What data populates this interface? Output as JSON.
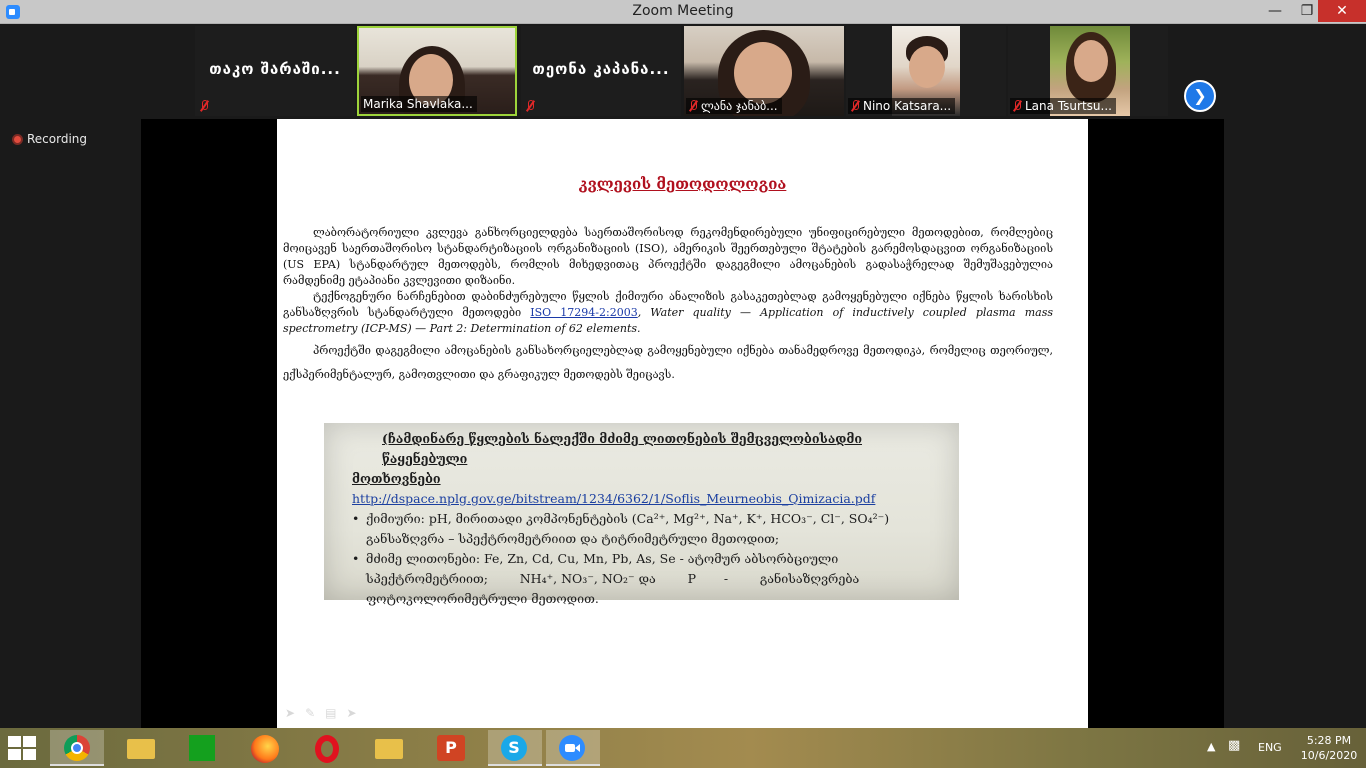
{
  "window": {
    "title": "Zoom Meeting"
  },
  "participants": [
    {
      "name": "თაკო შარაში..."
    },
    {
      "name": "Marika Shavlaka..."
    },
    {
      "name": "თეონა კაპანა..."
    },
    {
      "name": "ლანა ჯანაბ..."
    },
    {
      "name": "Nino Katsara..."
    },
    {
      "name": "Lana Tsurtsu..."
    }
  ],
  "recording": {
    "label": "Recording"
  },
  "slide": {
    "title": "კვლევის მეთოდოლოგია",
    "p1": "ლაბორატორიული კვლევა განხორციელდება საერთაშორისოდ რეკომენდირებული უნიფიცირებული მეთოდებით, რომლებიც მოიცავენ საერთაშორისო სტანდარტიზაციის ორგანიზაციის (ISO), ამერიკის შეერთებული შტატების გარემოსდაცვით ორგანიზაციის (US EPA) სტანდარტულ მეთოდებს, რომლის მიხედვითაც პროექტში დაგეგმილი ამოცანების გადასაჭრელად შემუშავებულია რამდენიმე ეტაპიანი კვლევითი დიზაინი.",
    "p2_pre": "ტექნოგენური ნარჩენებით დაბინძურებული წყლის ქიმიური ანალიზის გასაკეთებლად გამოყენებული იქნება წყლის ხარისხის განსაზღვრის სტანდარტული მეთოდები ",
    "p2_link": "ISO 17294-2:2003",
    "p2_italic": ", Water quality — Application of inductively coupled plasma mass spectrometry (ICP-MS) — Part 2: Determination of 62 elements.",
    "p3": "პროექტში დაგეგმილი ამოცანების განსახორციელებლად გამოყენებული იქნება თანამედროვე მეთოდიკა, რომელიც თეორიულ, ექსპერიმენტალურ, გამოთვლითი და გრაფიკულ მეთოდებს შეიცავს."
  },
  "photo": {
    "heading": "(ჩამდინარე წყლების ნალექში მძიმე ლითონების შემცველობისადმი წაყენებული",
    "heading2": "მოთხოვნები",
    "link": "http://dspace.nplg.gov.ge/bitstream/1234/6362/1/Soflis_Meurneobis_Qimizacia.pdf",
    "bullet1": "ქიმიური: pH, მირითადი კომპონენტების (Ca²⁺, Mg²⁺, Na⁺, K⁺, HCO₃⁻, Cl⁻, SO₄²⁻)",
    "bullet1b": "განსაზღვრა – სპექტრომეტრიით და ტიტრიმეტრული მეთოდით;",
    "bullet2": "მძიმე ლითონები: Fe, Zn, Cd, Cu, Mn, Pb, As, Se - ატომურ აბსორბციული",
    "bullet2b": "სპექტრომეტრიით;        NH₄⁺, NO₃⁻, NO₂⁻ და        P       -        განისაზღვრება",
    "bullet2c": "ფოტოკოლორიმეტრული მეთოდით."
  },
  "taskbar": {
    "language": "ENG",
    "time": "5:28 PM",
    "date": "10/6/2020"
  }
}
